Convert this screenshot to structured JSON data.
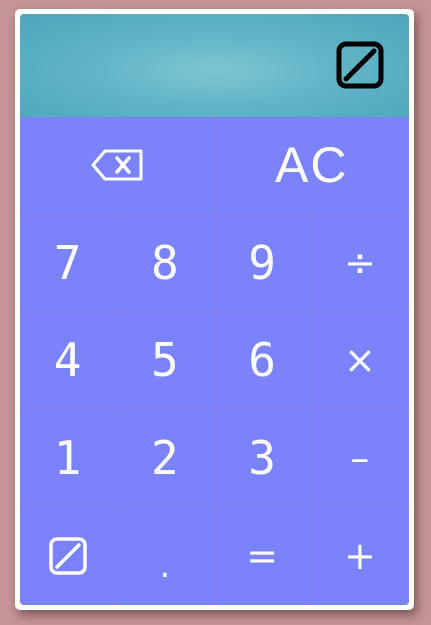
{
  "display": {
    "icon": "null-sign-icon"
  },
  "keypad": {
    "backspace_icon": "backspace-icon",
    "clear_label": "AC",
    "digits": {
      "seven": "7",
      "eight": "8",
      "nine": "9",
      "four": "4",
      "five": "5",
      "six": "6",
      "one": "1",
      "two": "2",
      "three": "3"
    },
    "operators": {
      "divide": "÷",
      "multiply": "×",
      "subtract": "–",
      "add": "+",
      "equals": "="
    },
    "decimal_label": ".",
    "null_icon": "null-sign-icon"
  },
  "colors": {
    "background": "#c39595",
    "display": "#62b4c6",
    "keypad": "#7a83fc",
    "key_divider": "#8f7fe6",
    "text": "#ffffff"
  }
}
